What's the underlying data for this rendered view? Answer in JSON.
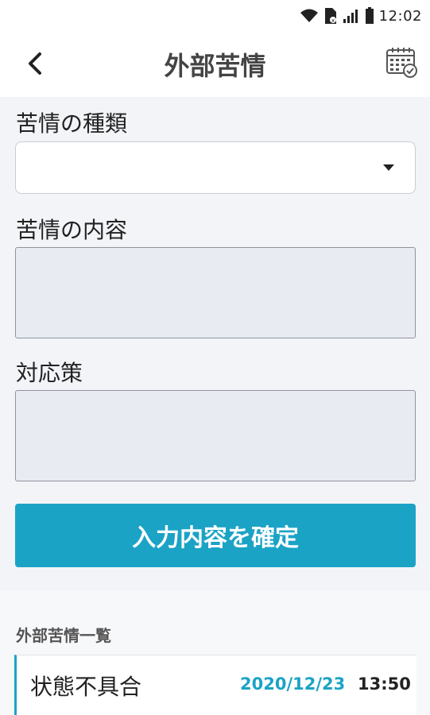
{
  "status_bar": {
    "time": "12:02",
    "icons": [
      "wifi-icon",
      "sim-icon",
      "signal-icon",
      "battery-icon"
    ]
  },
  "header": {
    "title": "外部苦情",
    "back_icon": "chevron-left-icon",
    "calendar_icon": "calendar-check-icon"
  },
  "form": {
    "complaint_type_label": "苦情の種類",
    "complaint_type_value": "",
    "complaint_content_label": "苦情の内容",
    "complaint_content_value": "",
    "countermeasure_label": "対応策",
    "countermeasure_value": "",
    "confirm_label": "入力内容を確定"
  },
  "list": {
    "heading": "外部苦情一覧",
    "items": [
      {
        "title": "状態不具合",
        "date": "2020/12/23",
        "time": "13:50"
      }
    ]
  },
  "colors": {
    "accent": "#1ba3c6",
    "background": "#f2f4f8",
    "textarea_bg": "#e8ebf1"
  }
}
